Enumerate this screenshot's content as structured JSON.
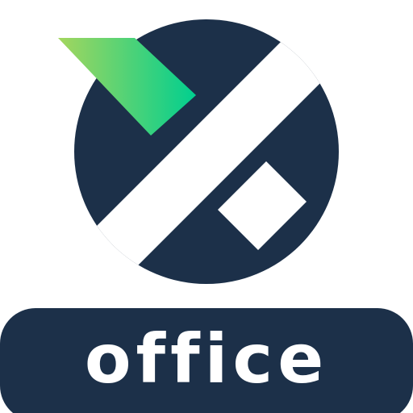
{
  "app": {
    "label": "office"
  },
  "colors": {
    "navy": "#1c3049",
    "white": "#ffffff",
    "gradient_start": "#a4d65e",
    "gradient_end": "#00cf8f"
  },
  "icons": {
    "logo": "circle-x-logo-icon",
    "checkmark": "green-chevron-icon"
  }
}
